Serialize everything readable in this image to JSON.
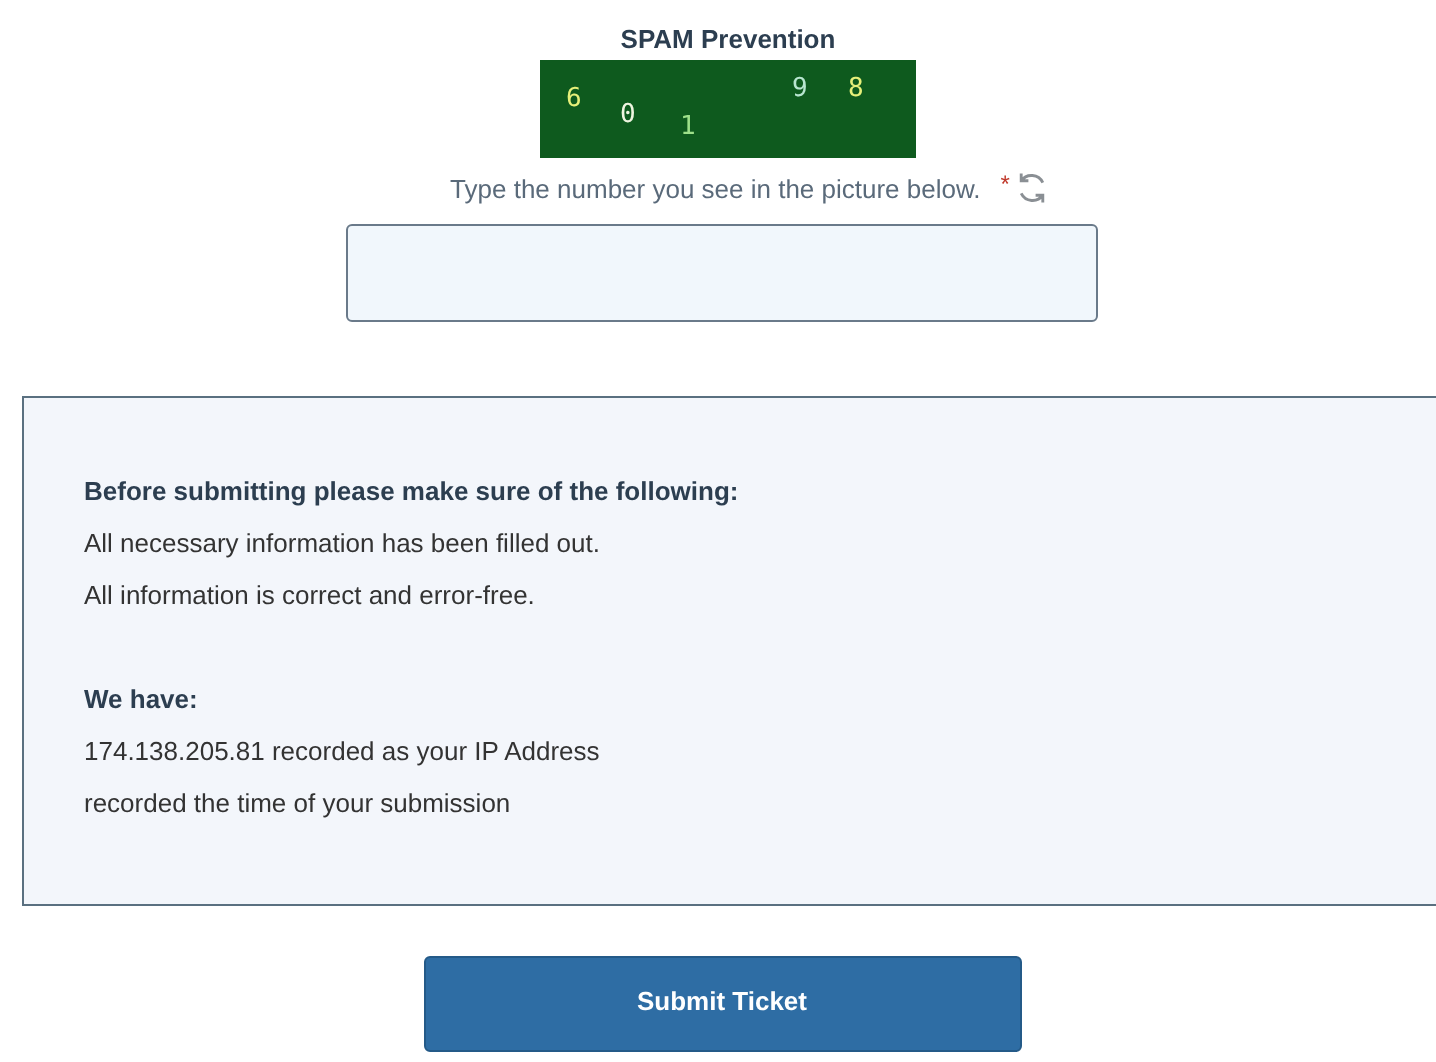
{
  "spam_prevention": {
    "title": "SPAM Prevention",
    "captcha_digits": [
      {
        "text": "6",
        "color": "#e6f07a"
      },
      {
        "text": "0",
        "color": "#eef5e0"
      },
      {
        "text": "1",
        "color": "#9ee08a"
      },
      {
        "text": "9",
        "color": "#b8e6d0"
      },
      {
        "text": "8",
        "color": "#e6f07a"
      }
    ],
    "instruction": "Type the number you see in the picture below.",
    "required_mark": "*"
  },
  "notice": {
    "heading": "Before submitting please make sure of the following:",
    "lines": [
      "All necessary information has been filled out.",
      "All information is correct and error-free."
    ],
    "subheading": "We have:",
    "records": [
      "174.138.205.81 recorded as your IP Address",
      "recorded the time of your submission"
    ]
  },
  "submit_button": "Submit Ticket"
}
